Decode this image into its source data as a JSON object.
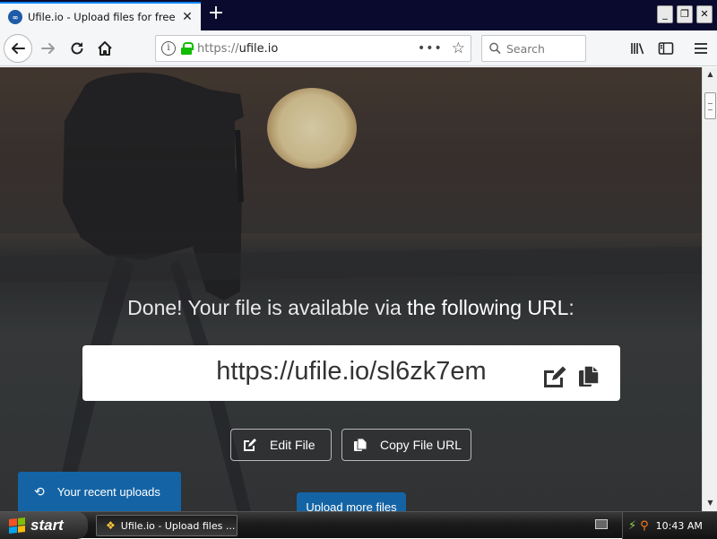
{
  "browser": {
    "tab": {
      "favicon": "ufile-logo-icon",
      "title": "Ufile.io - Upload files for free & share"
    },
    "new_tab_label": "+",
    "window_controls": {
      "minimize": "_",
      "maximize": "❐",
      "close": "✕"
    },
    "url": {
      "scheme": "https://",
      "host": "ufile.io"
    },
    "search_placeholder": "Search"
  },
  "page": {
    "headline_prefix": "Done! Your file is available via ",
    "headline_strong": "the following URL",
    "headline_suffix": ":",
    "file_url": "https://ufile.io/sl6zk7em",
    "edit_file_label": "Edit File",
    "copy_url_label": "Copy File URL",
    "recent_uploads_label": "Your recent uploads",
    "upload_more_label": "Upload more files"
  },
  "taskbar": {
    "start_label": "start",
    "task_label": "Ufile.io - Upload files ...",
    "clock": "10:43 AM"
  },
  "colors": {
    "accent_blue": "#1464a5",
    "browser_highlight": "#0a84ff",
    "secure_lock": "#12bc00"
  }
}
